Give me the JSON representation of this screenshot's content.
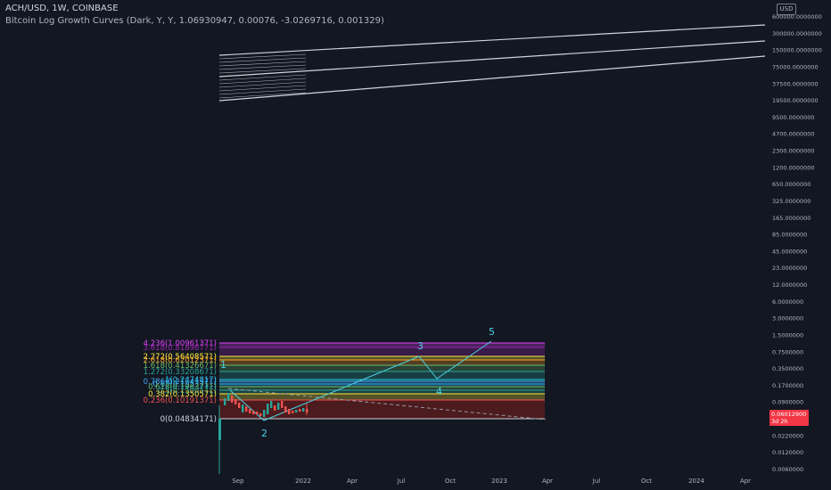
{
  "legend": {
    "symbol_line": "ACH/USD, 1W, COINBASE",
    "indicator_line": "Bitcoin Log Growth Curves (Dark, Y, Y, 1.06930947, 0.00076, -3.0269716, 0.001329)"
  },
  "currency_badge": "USD",
  "price_axis": {
    "labels": [
      "600000.0000000",
      "300000.0000000",
      "150000.0000000",
      "75000.0000000",
      "37500.0000000",
      "19500.0000000",
      "9500.0000000",
      "4700.0000000",
      "2300.0000000",
      "1200.0000000",
      "650.0000000",
      "325.0000000",
      "165.0000000",
      "85.0000000",
      "45.0000000",
      "23.0000000",
      "12.0000000",
      "6.0000000",
      "3.0000000",
      "1.5000000",
      "0.7500000",
      "0.3500000",
      "0.1700000",
      "0.0900000",
      "0.0430000",
      "0.0220000",
      "0.0120000",
      "0.0060000"
    ],
    "last_price": "0.06012900",
    "countdown": "3d 2h"
  },
  "time_axis": {
    "labels": [
      "Sep",
      "2022",
      "Apr",
      "Jul",
      "Oct",
      "2023",
      "Apr",
      "Jul",
      "Oct",
      "2024",
      "Apr"
    ]
  },
  "fib_levels": [
    {
      "label": "4.236(1.00961371)",
      "color": "#e040fb"
    },
    {
      "label": "3.618(0.81896771)",
      "color": "#9c27b0"
    },
    {
      "label": "2.272(0.56408571)",
      "color": "#ffeb3b"
    },
    {
      "label": "2.618(0.62012371)",
      "color": "#ffa726"
    },
    {
      "label": "1.618(0.41326671)",
      "color": "#66bb6a"
    },
    {
      "label": "1.272(0.33208671)",
      "color": "#26a69a"
    },
    {
      "label": "1(0.2474817)",
      "color": "#26c6da"
    },
    {
      "label": "0.786(0.21741371)",
      "color": "#42a5f5"
    },
    {
      "label": "0.65(0.1953711)",
      "color": "#29b6f6"
    },
    {
      "label": "0.618(0.1963771)",
      "color": "#66bb6a"
    },
    {
      "label": "0.5(0.1500571)",
      "color": "#26a69a"
    },
    {
      "label": "0.382(0.1350571)",
      "color": "#ffeb3b"
    },
    {
      "label": "0.236(0.10191371)",
      "color": "#ef5350"
    },
    {
      "label": "0(0.04834171)",
      "color": "#d1d4dc"
    }
  ],
  "wave_labels": [
    "1",
    "2",
    "3",
    "4",
    "5"
  ],
  "colors": {
    "background": "#131722",
    "wave": "#4dd0e1",
    "bull": "#26a69a",
    "bear": "#ef5350",
    "price_tag": "#f23645"
  }
}
